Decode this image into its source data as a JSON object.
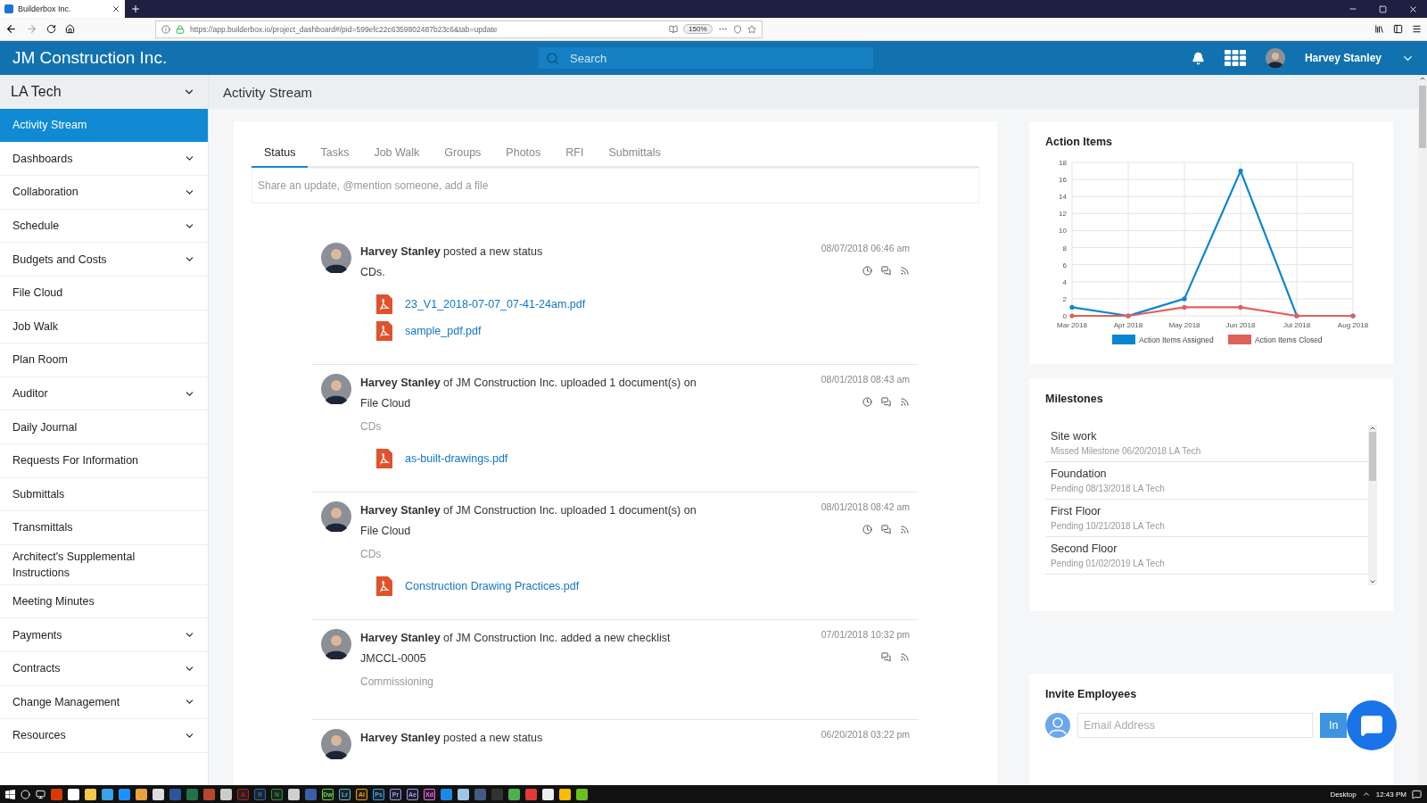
{
  "browser": {
    "tab_title": "Builderbox Inc.",
    "url": "https://app.builderbox.io/project_dashboard#/pid=599efc22c6359802487b23c6&tab=update",
    "zoom": "150%"
  },
  "header": {
    "company": "JM Construction Inc.",
    "search_placeholder": "Search",
    "user": "Harvey Stanley"
  },
  "sidebar": {
    "project": "LA Tech",
    "items": [
      {
        "label": "Activity Stream",
        "selected": true,
        "expandable": false
      },
      {
        "label": "Dashboards",
        "selected": false,
        "expandable": true
      },
      {
        "label": "Collaboration",
        "selected": false,
        "expandable": true
      },
      {
        "label": "Schedule",
        "selected": false,
        "expandable": true
      },
      {
        "label": "Budgets and Costs",
        "selected": false,
        "expandable": true
      },
      {
        "label": "File Cloud",
        "selected": false,
        "expandable": false
      },
      {
        "label": "Job Walk",
        "selected": false,
        "expandable": false
      },
      {
        "label": "Plan Room",
        "selected": false,
        "expandable": false
      },
      {
        "label": "Auditor",
        "selected": false,
        "expandable": true
      },
      {
        "label": "Daily Journal",
        "selected": false,
        "expandable": false
      },
      {
        "label": "Requests For Information",
        "selected": false,
        "expandable": false
      },
      {
        "label": "Submittals",
        "selected": false,
        "expandable": false
      },
      {
        "label": "Transmittals",
        "selected": false,
        "expandable": false
      },
      {
        "label": "Architect's Supplemental Instructions",
        "selected": false,
        "expandable": false
      },
      {
        "label": "Meeting Minutes",
        "selected": false,
        "expandable": false
      },
      {
        "label": "Payments",
        "selected": false,
        "expandable": true
      },
      {
        "label": "Contracts",
        "selected": false,
        "expandable": true
      },
      {
        "label": "Change Management",
        "selected": false,
        "expandable": true
      },
      {
        "label": "Resources",
        "selected": false,
        "expandable": true
      }
    ]
  },
  "page_title": "Activity Stream",
  "tabs": [
    {
      "label": "Status",
      "selected": true
    },
    {
      "label": "Tasks",
      "selected": false
    },
    {
      "label": "Job Walk",
      "selected": false
    },
    {
      "label": "Groups",
      "selected": false
    },
    {
      "label": "Photos",
      "selected": false
    },
    {
      "label": "RFI",
      "selected": false
    },
    {
      "label": "Submittals",
      "selected": false
    }
  ],
  "composer": {
    "placeholder": "Share an update, @mention someone, add a file"
  },
  "feed": [
    {
      "text": "**Harvey Stanley** posted a new status",
      "date": "08/07/2018 06:46 am",
      "subtitle": "CDs.",
      "files": [
        "23_V1_2018-07-07_07-41-24am.pdf",
        "sample_pdf.pdf"
      ],
      "actions": [
        {
          "kind": "timer"
        },
        {
          "kind": "comment"
        },
        {
          "kind": "feed"
        }
      ]
    },
    {
      "text": "**Harvey Stanley** of JM Construction Inc. uploaded 1 document(s) on",
      "date": "08/01/2018 08:43 am",
      "subtitle": "File Cloud",
      "tag": "CDs",
      "files": [
        "as-built-drawings.pdf"
      ],
      "actions": [
        {
          "kind": "timer"
        },
        {
          "kind": "comment"
        },
        {
          "kind": "feed"
        }
      ]
    },
    {
      "text": "**Harvey Stanley** of JM Construction Inc. uploaded 1 document(s) on",
      "date": "08/01/2018 08:42 am",
      "subtitle": "File Cloud",
      "tag": "CDs",
      "files": [
        "Construction Drawing Practices.pdf"
      ],
      "actions": [
        {
          "kind": "timer"
        },
        {
          "kind": "comment"
        },
        {
          "kind": "feed"
        }
      ]
    },
    {
      "text": "**Harvey Stanley** of JM Construction Inc. added a new checklist",
      "date": "07/01/2018 10:32 pm",
      "subtitle": "JMCCL-0005",
      "tag": "Commissioning",
      "actions": [
        {
          "kind": "comment"
        },
        {
          "kind": "feed"
        }
      ]
    },
    {
      "text": "**Harvey Stanley** posted a new status",
      "date": "06/20/2018 03:22 pm"
    }
  ],
  "action_items": {
    "title": "Action Items",
    "chart_data": {
      "type": "line",
      "categories": [
        "Mar 2018",
        "Apr 2018",
        "May 2018",
        "Jun 2018",
        "Jul 2018",
        "Aug 2018"
      ],
      "ylim": [
        0,
        18
      ],
      "yticks": [
        0,
        2,
        4,
        6,
        8,
        10,
        12,
        14,
        16,
        18
      ],
      "grid": true,
      "legend": "bottom",
      "series": [
        {
          "name": "Action Items Assigned",
          "color": "#0a86d0",
          "values": [
            1,
            0,
            2,
            17,
            0,
            0
          ]
        },
        {
          "name": "Action Items Closed",
          "color": "#e0605c",
          "values": [
            0,
            0,
            1,
            1,
            0,
            0
          ]
        }
      ]
    }
  },
  "milestones": {
    "title": "Milestones",
    "items": [
      {
        "name": "Site work",
        "detail": "Missed Milestone 06/20/2018 LA Tech"
      },
      {
        "name": "Foundation",
        "detail": "Pending 08/13/2018 LA Tech"
      },
      {
        "name": "First Floor",
        "detail": "Pending 10/21/2018 LA Tech"
      },
      {
        "name": "Second Floor",
        "detail": "Pending 01/02/2019 LA Tech"
      }
    ]
  },
  "invite": {
    "title": "Invite Employees",
    "placeholder": "Email Address",
    "button": "In"
  },
  "taskbar": {
    "apps": [
      {
        "kind": "plain",
        "color": "#d83b01"
      },
      {
        "kind": "plain",
        "color": "#ffffff"
      },
      {
        "kind": "plain",
        "color": "#f2c94c"
      },
      {
        "kind": "plain",
        "color": "#3aa0e8"
      },
      {
        "kind": "plain",
        "color": "#1e90ff"
      },
      {
        "kind": "plain",
        "color": "#e8a33d"
      },
      {
        "kind": "plain",
        "color": "#dddddd"
      },
      {
        "kind": "plain",
        "color": "#2b579a"
      },
      {
        "kind": "plain",
        "color": "#217346"
      },
      {
        "kind": "plain",
        "color": "#b7472a"
      },
      {
        "kind": "plain",
        "color": "#cccccc"
      },
      {
        "kind": "letter",
        "color": "#c4161c",
        "label": "A"
      },
      {
        "kind": "letter",
        "color": "#1d6fb8",
        "label": "R"
      },
      {
        "kind": "letter",
        "color": "#1c9b3b",
        "label": "N"
      },
      {
        "kind": "plain",
        "color": "#cfcfcf"
      },
      {
        "kind": "plain",
        "color": "#3a5fa8"
      },
      {
        "kind": "letter",
        "color": "#5fdc3c",
        "label": "Dw"
      },
      {
        "kind": "letter",
        "color": "#4bb8e8",
        "label": "Lr"
      },
      {
        "kind": "letter",
        "color": "#ff9a00",
        "label": "Ai"
      },
      {
        "kind": "letter",
        "color": "#31a8ff",
        "label": "Ps"
      },
      {
        "kind": "letter",
        "color": "#9999ff",
        "label": "Pr"
      },
      {
        "kind": "letter",
        "color": "#9999ff",
        "label": "Ae"
      },
      {
        "kind": "letter",
        "color": "#ff61f6",
        "label": "Xd"
      },
      {
        "kind": "plain",
        "color": "#1e88e5"
      },
      {
        "kind": "plain",
        "color": "#9fc4e8"
      },
      {
        "kind": "plain",
        "color": "#445a80"
      },
      {
        "kind": "plain",
        "color": "#333333"
      },
      {
        "kind": "plain",
        "color": "#4caf50"
      },
      {
        "kind": "plain",
        "color": "#e53935"
      },
      {
        "kind": "plain",
        "color": "#eeeeee"
      },
      {
        "kind": "plain",
        "color": "#fbbc05"
      },
      {
        "kind": "plain",
        "color": "#6abf1e"
      }
    ],
    "desktop": "Desktop",
    "time": "12:43 PM"
  }
}
